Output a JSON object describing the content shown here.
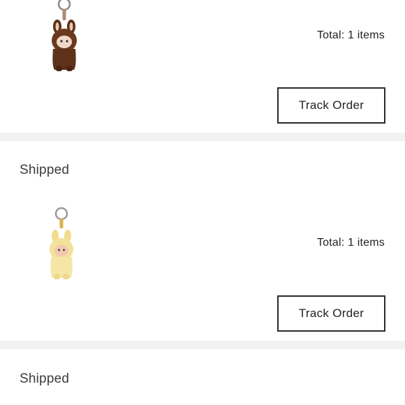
{
  "orders": [
    {
      "status": "",
      "total": "Total: 1 items",
      "track_label": "Track Order",
      "product_icon": "bunny-keychain-brown-icon",
      "product_color": "#6b3a1e"
    },
    {
      "status": "Shipped",
      "total": "Total: 1 items",
      "track_label": "Track Order",
      "product_icon": "bunny-keychain-yellow-icon",
      "product_color": "#f3e29a"
    },
    {
      "status": "Shipped"
    }
  ],
  "colors": {
    "divider": "#f2f2f2",
    "button_border": "#2a2a2a",
    "status_text": "#3c3c3c"
  }
}
